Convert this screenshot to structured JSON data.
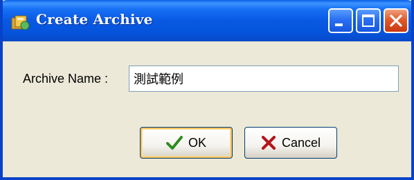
{
  "window": {
    "title": "Create Archive",
    "icon": "archive-app-icon",
    "controls": [
      "minimize",
      "maximize",
      "close"
    ]
  },
  "form": {
    "archive_name_label": "Archive Name :",
    "archive_name_value": "測試範例"
  },
  "buttons": {
    "ok_label": "OK",
    "ok_icon": "checkmark-icon",
    "cancel_label": "Cancel",
    "cancel_icon": "x-icon"
  },
  "colors": {
    "titlebar": "#0842C9",
    "dialog_bg": "#ECE9D8",
    "close_button": "#E25A2C",
    "ok_check": "#2E8B1F",
    "cancel_x": "#B3161B"
  }
}
